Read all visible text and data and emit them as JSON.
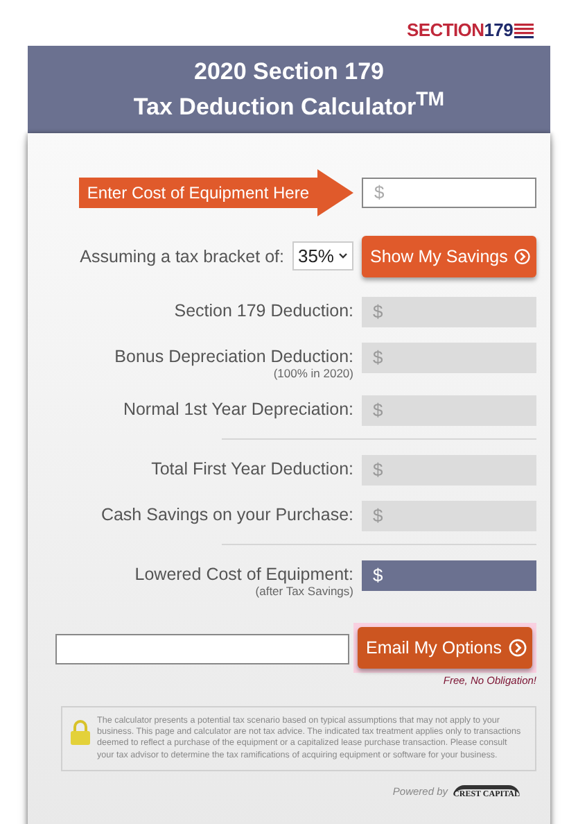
{
  "logo": {
    "word": "SECTION",
    "number": "179"
  },
  "title": {
    "line_1": "2020 Section 179",
    "line_2": "Tax Deduction Calculator$^{TM}$"
  },
  "cost": {
    "arrow_label": "Enter Cost of Equipment Here",
    "placeholder": "$"
  },
  "bracket": {
    "label": "Assuming a tax bracket of:",
    "value": "35%",
    "button": "Show My Savings"
  },
  "results": [
    {
      "label": "Section 179 Deduction:",
      "value": "$",
      "kind": "plain",
      "divider_before": false
    },
    {
      "label": "Bonus Depreciation Deduction:",
      "note": "(100% in 2020)",
      "value": "$",
      "kind": "plain",
      "divider_before": false
    },
    {
      "label": "Normal 1st Year Depreciation:",
      "value": "$",
      "kind": "plain",
      "divider_before": false
    },
    {
      "label": "Total First Year Deduction:",
      "value": "$",
      "kind": "plain",
      "divider_before": true
    },
    {
      "label": "Cash Savings on your Purchase:",
      "value": "$",
      "kind": "plain",
      "divider_before": false
    },
    {
      "label": "Lowered Cost of Equipment:",
      "note": "(after Tax Savings)",
      "value": "$",
      "kind": "highlight",
      "divider_before": true
    }
  ],
  "email": {
    "button": "Email My Options",
    "note": "Free, No Obligation!"
  },
  "disclaimer": "The calculator presents a potential tax scenario based on typical assumptions that may not apply to your business. This page and calculator are not tax advice. The indicated tax treatment applies only to transactions deemed to reflect a purchase of the equipment or a capitalized lease purchase transaction. Please consult your tax advisor to determine the tax ramifications of acquiring equipment or software for your business.",
  "powered_by": {
    "label": "Powered by",
    "brand": "CREST CAPITAL"
  }
}
